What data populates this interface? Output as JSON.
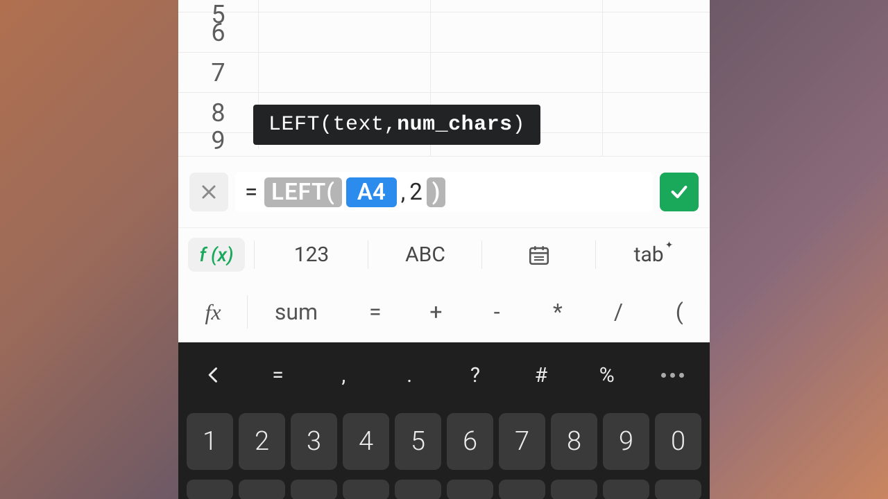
{
  "sheet": {
    "visible_rows": [
      "5",
      "6",
      "7",
      "8",
      "9"
    ]
  },
  "tooltip": {
    "fn": "LEFT",
    "arg1": "text",
    "arg2": "num_chars"
  },
  "formula": {
    "eq": "=",
    "func": "LEFT(",
    "ref": "A4",
    "comma": ",",
    "num": "2",
    "close": ")"
  },
  "tabs": {
    "fx": "f (x)",
    "num": "123",
    "abc": "ABC",
    "tab": "tab"
  },
  "fn_row": {
    "fx": "fx",
    "sum": "sum",
    "eq": "=",
    "plus": "+",
    "minus": "-",
    "mul": "*",
    "div": "/",
    "lp": "("
  },
  "kb_sym": {
    "eq": "=",
    "comma": ",",
    "dot": ".",
    "q": "?",
    "hash": "#",
    "pct": "%"
  },
  "kb_nums": [
    "1",
    "2",
    "3",
    "4",
    "5",
    "6",
    "7",
    "8",
    "9",
    "0"
  ]
}
